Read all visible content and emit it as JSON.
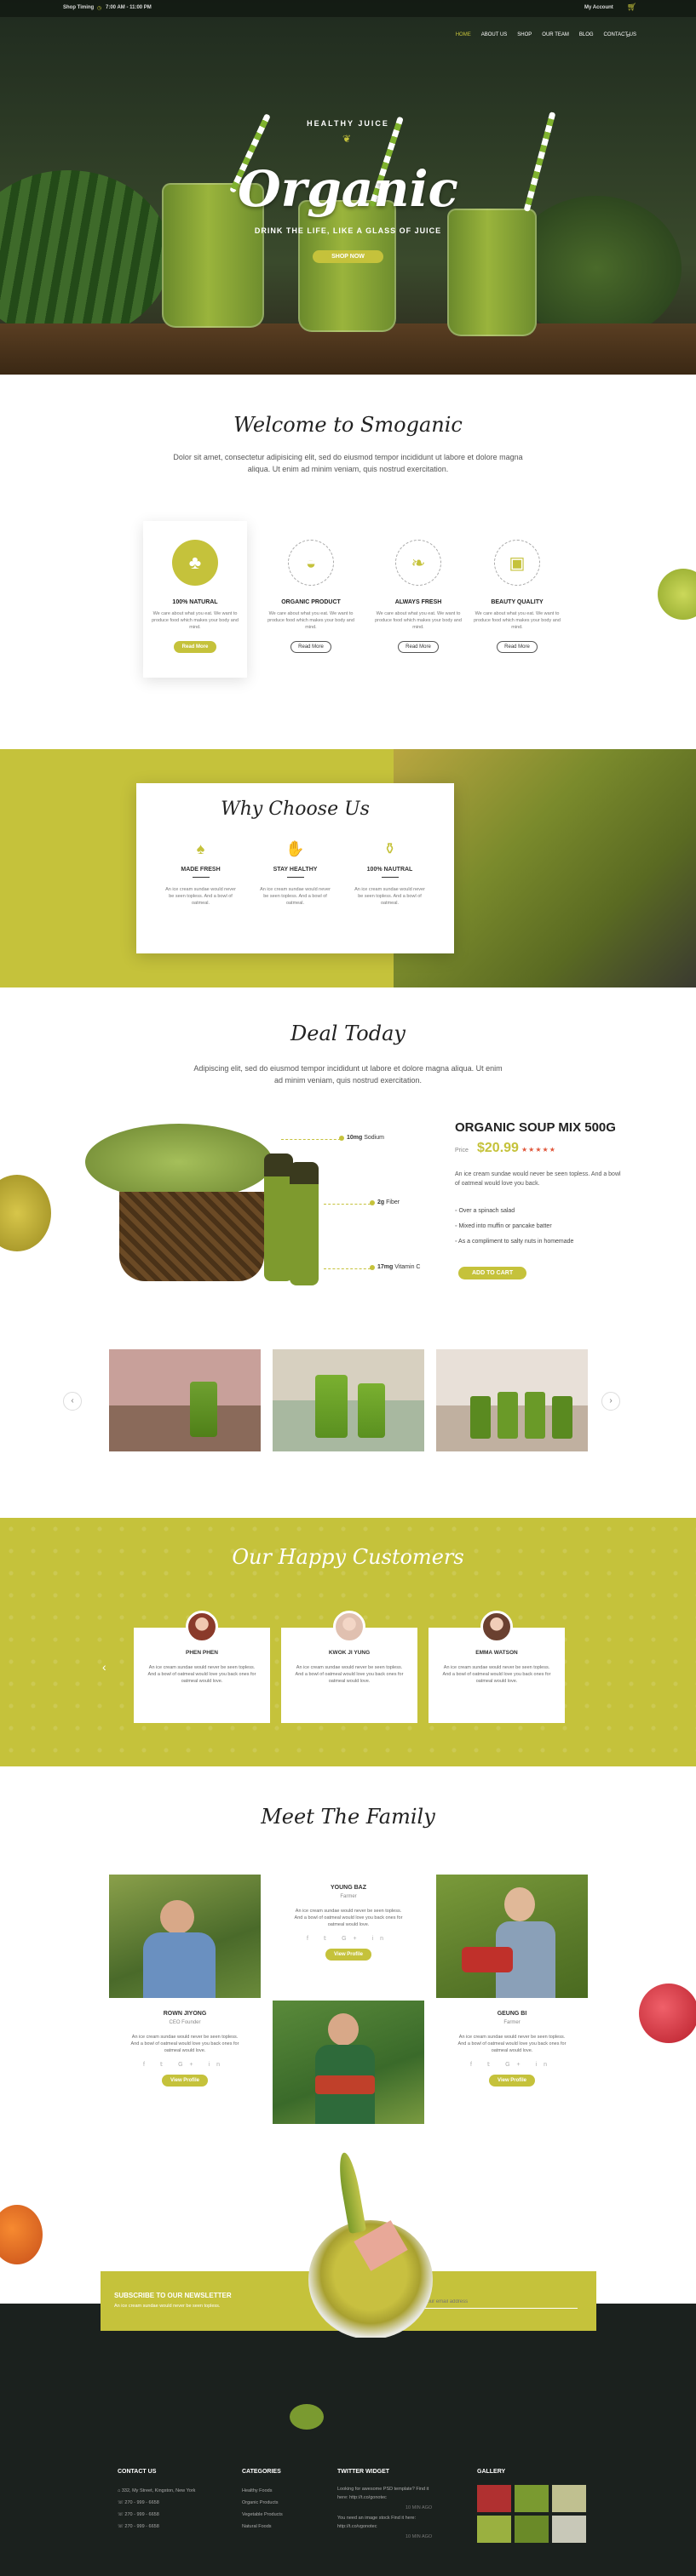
{
  "topbar": {
    "shop_timing": "Shop Timing",
    "hours": "7:00 AM - 11:00 PM",
    "account": "My Account"
  },
  "nav": {
    "items": [
      "HOME",
      "ABOUT US",
      "SHOP",
      "OUR TEAM",
      "BLOG",
      "CONTACT US"
    ],
    "active": "HOME"
  },
  "hero": {
    "tag": "HEALTHY JUICE",
    "title": "Organic",
    "subtitle": "DRINK THE LIFE, LIKE A GLASS OF JUICE",
    "button": "SHOP NOW"
  },
  "welcome": {
    "title": "Welcome to Smoganic",
    "text1": "Dolor sit amet, consectetur adipisicing elit, sed do eiusmod tempor incididunt ut labore et dolore magna",
    "text2": "aliqua. Ut enim ad minim veniam, quis nostrud exercitation.",
    "features": [
      {
        "title": "100% NATURAL",
        "icon": "broccoli-icon",
        "button": "Read More"
      },
      {
        "title": "ORGANIC PRODUCT",
        "icon": "apple-icon",
        "button": "Read More"
      },
      {
        "title": "ALWAYS FRESH",
        "icon": "leaf-icon",
        "button": "Read More"
      },
      {
        "title": "BEAUTY QUALITY",
        "icon": "jar-icon",
        "button": "Read More"
      }
    ],
    "feature_text": "We care about what you eat. We want to produce food which makes your body and mind."
  },
  "why": {
    "title": "Why Choose Us",
    "items": [
      {
        "title": "MADE FRESH",
        "icon": "sprout-icon"
      },
      {
        "title": "STAY HEALTHY",
        "icon": "hand-apple-icon"
      },
      {
        "title": "100% NAUTRAL",
        "icon": "bottle-icon"
      }
    ],
    "item_text": "An ice cream sundae would never be seen topless. And a bowl of oatmeal."
  },
  "deal": {
    "title": "Deal Today",
    "text1": "Adipiscing elit, sed do eiusmod tempor incididunt ut labore et dolore magna aliqua. Ut enim",
    "text2": "ad minim veniam, quis nostrud exercitation.",
    "labels": [
      {
        "amount": "10mg",
        "name": "Sodium"
      },
      {
        "amount": "2g",
        "name": "Fiber"
      },
      {
        "amount": "17mg",
        "name": "Vitamin C"
      }
    ],
    "product": "ORGANIC SOUP MIX 500G",
    "price_label": "Price",
    "price": "$20.99",
    "rating": 5,
    "desc1": "An ice cream sundae would never be seen topless. And a bowl",
    "desc2": "of oatmeal would love you back.",
    "bullets": [
      "Over a spinach salad",
      "Mixed into muffin or pancake batter",
      "As a compliment to salty nuts in homemade"
    ],
    "button": "ADD TO CART"
  },
  "customers": {
    "title": "Our Happy Customers",
    "items": [
      {
        "name": "PHEN PHEN"
      },
      {
        "name": "KWOK JI YUNG"
      },
      {
        "name": "EMMA WATSON"
      }
    ],
    "quote": "An ice cream sundae would never be seen topless. And a bowl of oatmeal would love you back ones for oatmeal would love."
  },
  "family": {
    "title": "Meet The Family",
    "members": [
      {
        "name": "YOUNG BAZ",
        "role": "Farmer",
        "button": "View Profile"
      },
      {
        "name": "ROWN JIYONG",
        "role": "CEO Founder",
        "button": "View Profile"
      },
      {
        "name": "GEUNG BI",
        "role": "Farmer",
        "button": "View Profile"
      }
    ],
    "bio": "An ice cream sundae would never be seen topless. And a bowl of oatmeal would love you back ones for oatmeal would love."
  },
  "newsletter": {
    "title": "SUBSCRIBE TO OUR NEWSLETTER",
    "sub": "An ice cream sundae would never be seen topless.",
    "placeholder": "Your email address"
  },
  "footer": {
    "contact": {
      "title": "CONTACT US",
      "lines": [
        "332, My Street, Kingston, New York",
        "270 - 999 - 6658",
        "270 - 999 - 6658",
        "270 - 999 - 6658"
      ]
    },
    "categories": {
      "title": "CATEGORIES",
      "items": [
        "Healthy Foods",
        "Organic Products",
        "Vegetable Products",
        "Natural Foods"
      ]
    },
    "twitter": {
      "title": "TWITTER WIDGET",
      "tweets": [
        "Looking for awesome PSD template? Find it here: http://t.co/gonotec",
        "You need an image stock Find it here: http://t.co/vgonotec"
      ],
      "time": "10 MIN AGO"
    },
    "gallery": {
      "title": "GALLERY"
    }
  },
  "colors": {
    "accent": "#c5c23b",
    "dark": "#1b211e"
  }
}
